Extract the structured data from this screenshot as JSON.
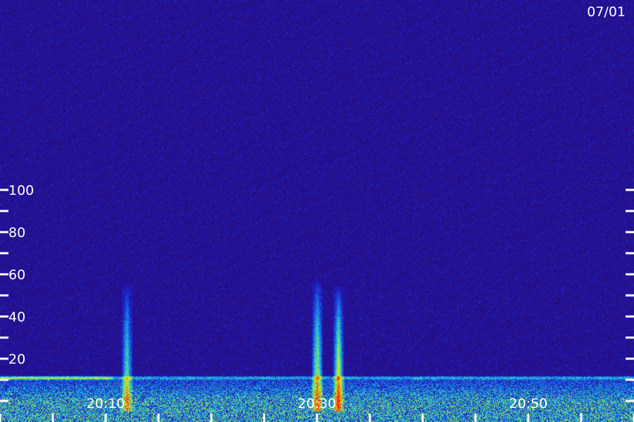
{
  "date_label": "07/01",
  "chart_data": {
    "type": "heatmap",
    "title": "",
    "xlabel": "",
    "ylabel": "",
    "x_tick_labels": [
      "20:10",
      "20:30",
      "20:50"
    ],
    "y_tick_labels": [
      "20",
      "40",
      "60",
      "80",
      "100"
    ],
    "y_ticks": [
      20,
      40,
      60,
      80,
      100
    ],
    "ylim": [
      0,
      105
    ],
    "grid": false,
    "colormap": [
      "#2a0a6a",
      "#1c1cc8",
      "#1a78e6",
      "#22d0d8",
      "#9ef23a",
      "#f0e21c",
      "#f08a12",
      "#e81616"
    ],
    "background_color": "#2a0a6a",
    "features": [
      {
        "kind": "vertical-burst",
        "time": "20:12",
        "max_frequency": 56,
        "peak_intensity": 0.75
      },
      {
        "kind": "vertical-burst",
        "time": "20:30",
        "max_frequency": 58,
        "peak_intensity": 0.95
      },
      {
        "kind": "vertical-burst",
        "time": "20:32",
        "max_frequency": 55,
        "peak_intensity": 1.0
      },
      {
        "kind": "horizontal-band",
        "frequency": 11,
        "peak_intensity": 0.6
      },
      {
        "kind": "low-frequency-noise-floor",
        "frequency_range": [
          0,
          12
        ],
        "peak_intensity": 0.55
      }
    ]
  }
}
